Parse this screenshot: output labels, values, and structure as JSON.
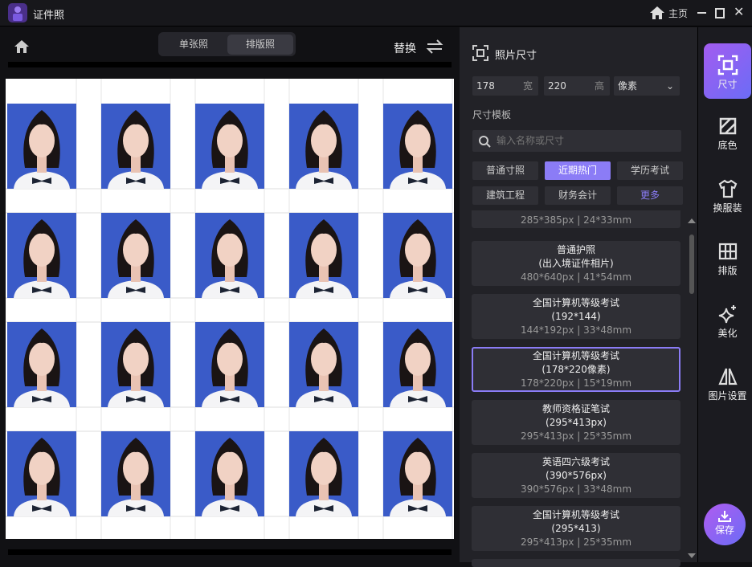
{
  "app": {
    "title": "证件照",
    "home_label": "主页"
  },
  "toolbar": {
    "mode_tabs": [
      {
        "label": "单张照",
        "active": false
      },
      {
        "label": "排版照",
        "active": true
      }
    ],
    "replace_label": "替换"
  },
  "layout": {
    "rows": 4,
    "cols": 5,
    "photo_bg": "#3a5bc8"
  },
  "panel": {
    "title": "照片尺寸",
    "width_value": "178",
    "width_suffix": "宽",
    "height_value": "220",
    "height_suffix": "高",
    "unit": "像素",
    "templates_label": "尺寸模板",
    "search_placeholder": "输入名称或尺寸",
    "categories": [
      {
        "label": "普通寸照"
      },
      {
        "label": "近期热门",
        "active": true
      },
      {
        "label": "学历考试"
      },
      {
        "label": "建筑工程"
      },
      {
        "label": "财务会计"
      },
      {
        "label": "更多"
      }
    ],
    "partial_card": "285*385px | 24*33mm",
    "cards": [
      {
        "title": "普通护照",
        "subtitle": "(出入境证件相片)",
        "size": "480*640px | 41*54mm"
      },
      {
        "title": "全国计算机等级考试",
        "subtitle": "(192*144)",
        "size": "144*192px | 33*48mm"
      },
      {
        "title": "全国计算机等级考试",
        "subtitle": "(178*220像素)",
        "size": "178*220px | 15*19mm",
        "selected": true
      },
      {
        "title": "教师资格证笔试",
        "subtitle": "(295*413px)",
        "size": "295*413px | 25*35mm"
      },
      {
        "title": "英语四六级考试",
        "subtitle": "(390*576px)",
        "size": "390*576px | 33*48mm"
      },
      {
        "title": "全国计算机等级考试",
        "subtitle": "(295*413)",
        "size": "295*413px | 25*35mm"
      }
    ]
  },
  "sidebar": {
    "items": [
      {
        "label": "尺寸",
        "active": true
      },
      {
        "label": "底色"
      },
      {
        "label": "换服装"
      },
      {
        "label": "排版"
      },
      {
        "label": "美化"
      },
      {
        "label": "图片设置"
      }
    ],
    "save_label": "保存"
  },
  "colors": {
    "accent": "#8b7cf6",
    "gradient_start": "#a35cf0",
    "gradient_end": "#6b6cf6"
  }
}
